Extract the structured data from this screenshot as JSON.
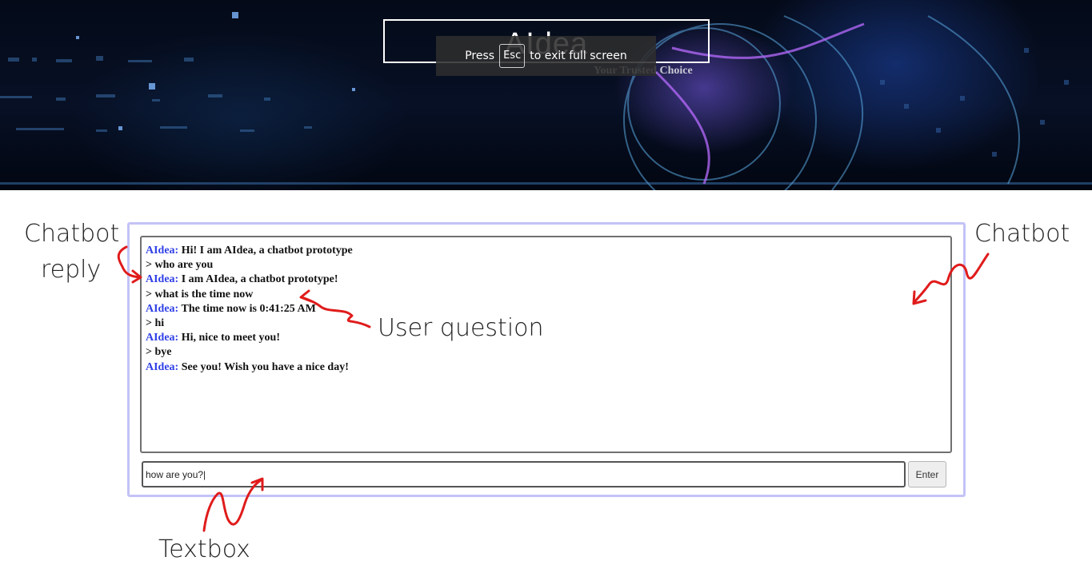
{
  "header": {
    "title": "AIdea",
    "tagline": "Your Trusted Choice"
  },
  "fullscreen_notice": {
    "prefix": "Press",
    "key": "Esc",
    "suffix": "to exit full screen"
  },
  "chat": {
    "bot_name": "AIdea:",
    "messages": [
      {
        "role": "bot",
        "text": " Hi! I am AIdea, a chatbot prototype"
      },
      {
        "role": "user",
        "text": "> who are you"
      },
      {
        "role": "bot",
        "text": " I am AIdea, a chatbot prototype!"
      },
      {
        "role": "user",
        "text": "> what is the time now"
      },
      {
        "role": "bot",
        "text": " The time now is 0:41:25 AM"
      },
      {
        "role": "user",
        "text": "> hi"
      },
      {
        "role": "bot",
        "text": " Hi, nice to meet you!"
      },
      {
        "role": "user",
        "text": "> bye"
      },
      {
        "role": "bot",
        "text": " See you! Wish you have a nice day!"
      }
    ],
    "input_value": "how are you?|",
    "enter_label": "Enter"
  },
  "annotations": {
    "chatbot_reply_line1": "Chatbot",
    "chatbot_reply_line2": "reply",
    "user_question": "User question",
    "chatbot": "Chatbot",
    "textbox": "Textbox",
    "arrow_color": "#e01b1b"
  },
  "colors": {
    "bot_name": "#2f3fe6",
    "frame_border": "#c3c3f7"
  }
}
